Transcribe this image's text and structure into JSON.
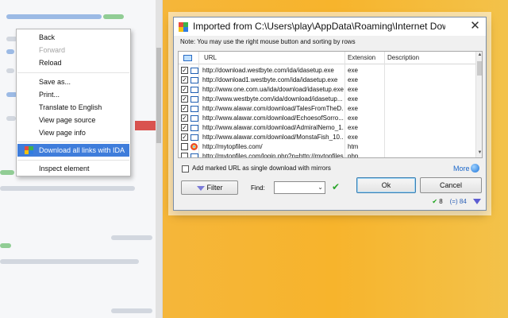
{
  "context_menu": {
    "items": [
      {
        "label": "Back"
      },
      {
        "label": "Forward"
      },
      {
        "label": "Reload"
      },
      {
        "label": "Save as..."
      },
      {
        "label": "Print..."
      },
      {
        "label": "Translate to English"
      },
      {
        "label": "View page source"
      },
      {
        "label": "View page info"
      },
      {
        "label": "Download all links with IDA"
      },
      {
        "label": "Inspect element"
      }
    ]
  },
  "dialog": {
    "title": "Imported from C:\\Users\\play\\AppData\\Roaming\\Internet Downl...",
    "close_symbol": "✕",
    "note": "Note: You may use the right mouse button and sorting by rows",
    "columns": [
      "URL",
      "Extension",
      "Description"
    ],
    "rows": [
      {
        "checked": true,
        "icon": "file-icon",
        "url": "http://download.westbyte.com/ida/idasetup.exe",
        "ext": "exe"
      },
      {
        "checked": true,
        "icon": "file-icon",
        "url": "http://download1.westbyte.com/ida/idasetup.exe",
        "ext": "exe"
      },
      {
        "checked": true,
        "icon": "file-icon",
        "url": "http://www.one.com.ua/ida/download/idasetup.exe",
        "ext": "exe"
      },
      {
        "checked": true,
        "icon": "file-icon",
        "url": "http://www.westbyte.com/ida/download/idasetup...",
        "ext": "exe"
      },
      {
        "checked": true,
        "icon": "file-icon",
        "url": "http://www.alawar.com/download/TalesFromTheD...",
        "ext": "exe"
      },
      {
        "checked": true,
        "icon": "file-icon",
        "url": "http://www.alawar.com/download/EchoesofSorro...",
        "ext": "exe"
      },
      {
        "checked": true,
        "icon": "file-icon",
        "url": "http://www.alawar.com/download/AdmiralNemo_1...",
        "ext": "exe"
      },
      {
        "checked": true,
        "icon": "file-icon",
        "url": "http://www.alawar.com/download/MonstaFish_10...",
        "ext": "exe"
      },
      {
        "checked": false,
        "icon": "chrome-icon",
        "url": "http://mytopfiles.com/",
        "ext": "htm"
      },
      {
        "checked": false,
        "icon": "file-icon",
        "url": "http://mytopfiles.com/login.php?p=http://mytopfiles...",
        "ext": "php"
      }
    ],
    "mirror_label": "Add marked URL as single download with mirrors",
    "more_label": "More",
    "filter_label": "Filter",
    "find_label": "Find:",
    "find_value": "",
    "ok_label": "Ok",
    "cancel_label": "Cancel",
    "status": {
      "checked_count": "8",
      "total_label": "(=) 84"
    }
  }
}
